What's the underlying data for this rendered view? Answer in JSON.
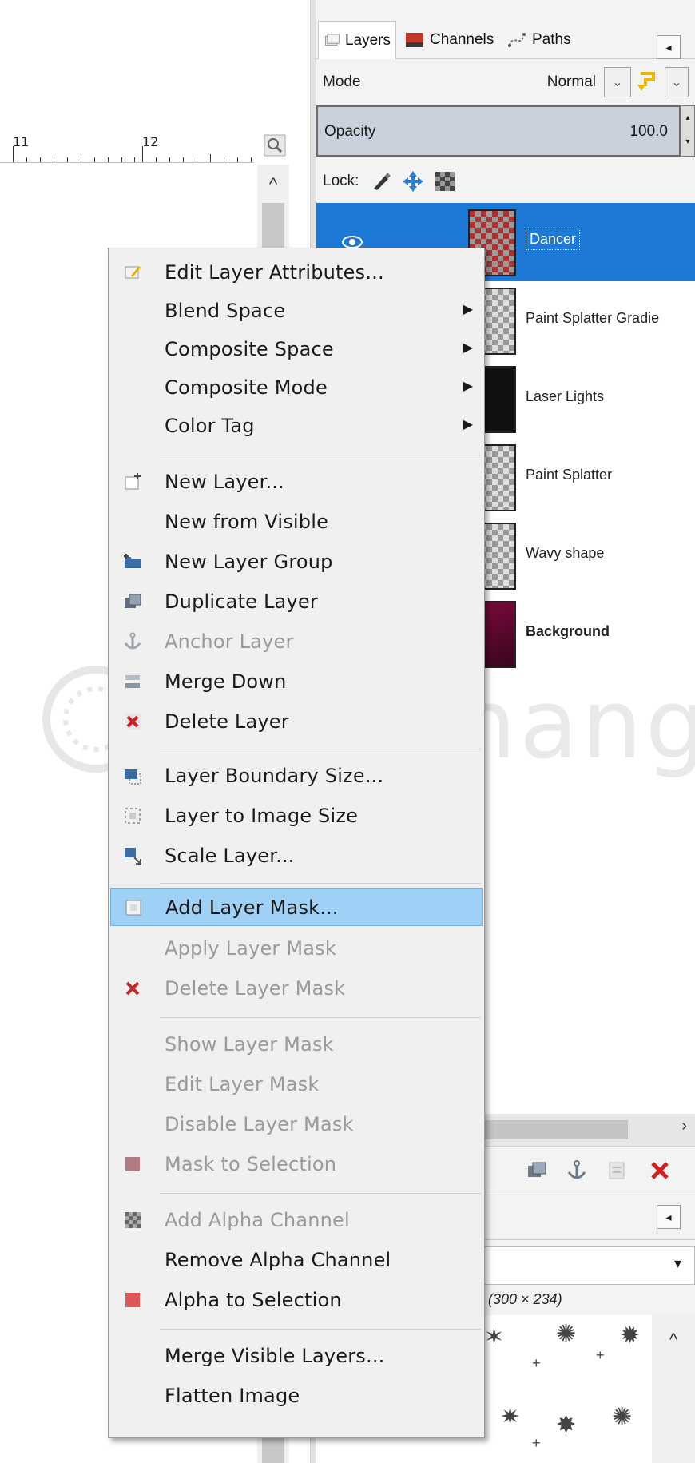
{
  "ruler": {
    "label_left": "11",
    "label_right": "12"
  },
  "tabs": [
    {
      "label": "Layers"
    },
    {
      "label": "Channels"
    },
    {
      "label": "Paths"
    }
  ],
  "mode": {
    "label": "Mode",
    "value": "Normal"
  },
  "opacity": {
    "label": "Opacity",
    "value": "100.0"
  },
  "lock": {
    "label": "Lock:"
  },
  "layers": [
    {
      "name": "Dancer",
      "selected": true
    },
    {
      "name": "Paint Splatter Gradie"
    },
    {
      "name": "Laser Lights"
    },
    {
      "name": "Paint Splatter"
    },
    {
      "name": "Wavy shape"
    },
    {
      "name": "Background"
    }
  ],
  "brush": {
    "caption": "4 (300 × 234)"
  },
  "watermark": {
    "text": "uantrimang"
  },
  "menu": {
    "items": [
      {
        "label": "Edit Layer Attributes...",
        "icon": "edit-attributes-icon"
      },
      {
        "label": "Blend Space",
        "submenu": true
      },
      {
        "label": "Composite Space",
        "submenu": true
      },
      {
        "label": "Composite Mode",
        "submenu": true
      },
      {
        "label": "Color Tag",
        "submenu": true
      },
      {
        "label": "New Layer...",
        "icon": "new-layer-icon"
      },
      {
        "label": "New from Visible"
      },
      {
        "label": "New Layer Group",
        "icon": "folder-icon"
      },
      {
        "label": "Duplicate Layer",
        "icon": "duplicate-icon"
      },
      {
        "label": "Anchor Layer",
        "icon": "anchor-icon",
        "disabled": true
      },
      {
        "label": "Merge Down",
        "icon": "merge-down-icon"
      },
      {
        "label": "Delete Layer",
        "icon": "delete-icon"
      },
      {
        "label": "Layer Boundary Size...",
        "icon": "boundary-size-icon"
      },
      {
        "label": "Layer to Image Size",
        "icon": "image-size-icon"
      },
      {
        "label": "Scale Layer...",
        "icon": "scale-icon"
      },
      {
        "label": "Add Layer Mask...",
        "icon": "add-mask-icon",
        "highlighted": true
      },
      {
        "label": "Apply Layer Mask",
        "disabled": true
      },
      {
        "label": "Delete Layer Mask",
        "icon": "delete-mask-icon",
        "disabled": true
      },
      {
        "label": "Show Layer Mask",
        "disabled": true
      },
      {
        "label": "Edit Layer Mask",
        "disabled": true
      },
      {
        "label": "Disable Layer Mask",
        "disabled": true
      },
      {
        "label": "Mask to Selection",
        "icon": "mask-selection-icon",
        "disabled": true
      },
      {
        "label": "Add Alpha Channel",
        "icon": "alpha-channel-icon",
        "disabled": true
      },
      {
        "label": "Remove Alpha Channel"
      },
      {
        "label": "Alpha to Selection",
        "icon": "alpha-selection-icon"
      },
      {
        "label": "Merge Visible Layers..."
      },
      {
        "label": "Flatten Image"
      }
    ]
  }
}
